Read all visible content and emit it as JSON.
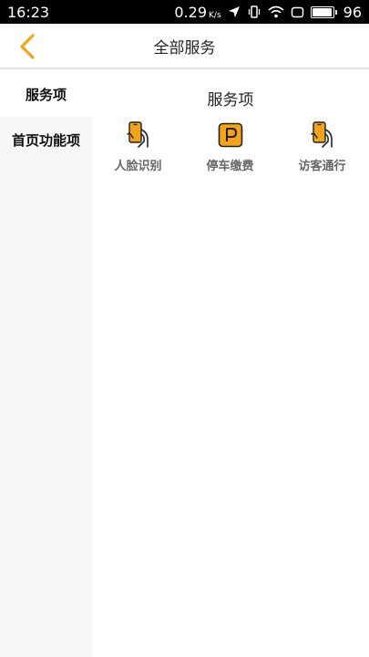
{
  "status_bar": {
    "time": "16:23",
    "speed_value": "0.29",
    "speed_unit": "K/s",
    "battery": "96",
    "battery_level": 0.96
  },
  "header": {
    "title": "全部服务",
    "back_icon": "chevron-left-icon"
  },
  "sidebar": {
    "items": [
      {
        "label": "服务项",
        "active": true
      },
      {
        "label": "首页功能项",
        "active": false
      }
    ]
  },
  "main": {
    "section_title": "服务项",
    "services": [
      {
        "label": "人脸识别",
        "icon": "hand-phone-icon"
      },
      {
        "label": "停车缴费",
        "icon": "parking-icon"
      },
      {
        "label": "访客通行",
        "icon": "hand-phone-icon"
      }
    ]
  },
  "colors": {
    "accent": "#f3a41a",
    "icon_stroke": "#222222",
    "sidebar_bg": "#f6f6f6"
  }
}
